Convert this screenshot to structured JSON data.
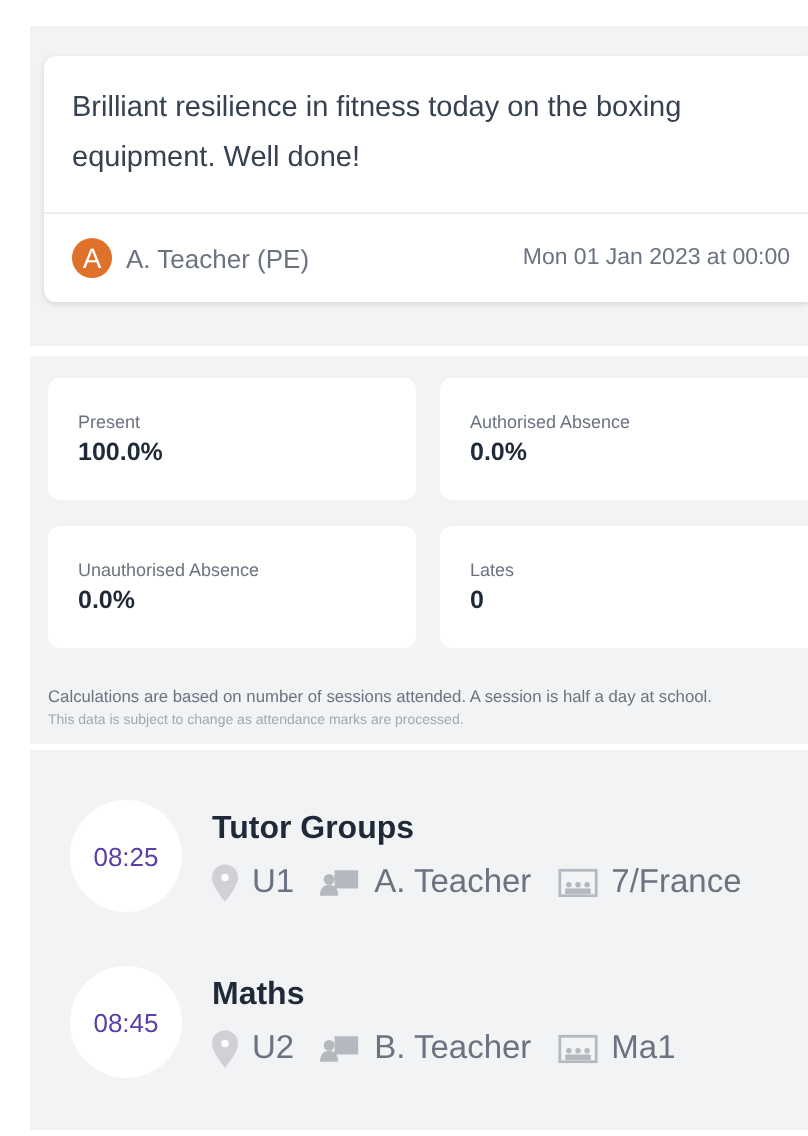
{
  "comment": {
    "text": "Brilliant resilience in fitness today on the boxing equipment. Well done!",
    "author_initial": "A",
    "author": "A. Teacher (PE)",
    "date": "Mon 01 Jan 2023 at 00:00"
  },
  "attendance": {
    "stats": [
      {
        "label": "Present",
        "value": "100.0%"
      },
      {
        "label": "Authorised Absence",
        "value": "0.0%"
      },
      {
        "label": "Unauthorised Absence",
        "value": "0.0%"
      },
      {
        "label": "Lates",
        "value": "0"
      }
    ],
    "note": "Calculations are based on number of sessions attended. A session is half a day at school.",
    "disclaimer": "This data is subject to change as attendance marks are processed."
  },
  "lessons": [
    {
      "time": "08:25",
      "title": "Tutor Groups",
      "room": "U1",
      "teacher": "A. Teacher",
      "group": "7/France"
    },
    {
      "time": "08:45",
      "title": "Maths",
      "room": "U2",
      "teacher": "B. Teacher",
      "group": "Ma1"
    }
  ]
}
